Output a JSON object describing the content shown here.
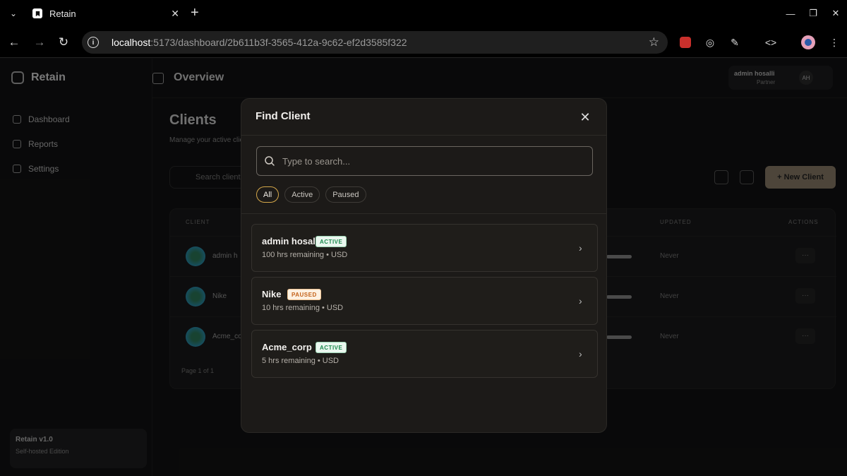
{
  "browser": {
    "tab_title": "Retain",
    "url_host": "localhost",
    "url_path": ":5173/dashboard/2b611b3f-3565-412a-9c62-ef2d3585f322"
  },
  "app_bg": {
    "brand": "Retain",
    "nav": [
      "Dashboard",
      "Reports",
      "Settings"
    ],
    "version_title": "Retain v1.0",
    "version_sub": "Self-hosted Edition",
    "topbar_title": "Overview",
    "user_name": "admin hosalli",
    "user_role": "Partner",
    "user_initials": "AH",
    "page_title": "Clients",
    "page_sub": "Manage your active clients",
    "search_placeholder": "Search clients...",
    "new_client": "+ New Client",
    "headers": {
      "client": "CLIENT",
      "updated": "UPDATED",
      "actions": "ACTIONS"
    },
    "rows": [
      {
        "name": "admin h",
        "updated": "Never"
      },
      {
        "name": "Nike",
        "updated": "Never"
      },
      {
        "name": "Acme_co",
        "updated": "Never"
      }
    ],
    "pager": "Page 1 of 1"
  },
  "modal": {
    "title": "Find Client",
    "search_placeholder": "Type to search...",
    "filters": [
      "All",
      "Active",
      "Paused"
    ],
    "active_filter": "All",
    "results": [
      {
        "name": "admin hosalli",
        "status": "ACTIVE",
        "meta": "100 hrs remaining • USD"
      },
      {
        "name": "Nike",
        "status": "PAUSED",
        "meta": "10 hrs remaining • USD"
      },
      {
        "name": "Acme_corp",
        "status": "ACTIVE",
        "meta": "5 hrs remaining • USD"
      }
    ]
  },
  "colors": {
    "accent_filter_border": "#d4a74a",
    "active_badge": "#1c8a4e",
    "paused_badge": "#c4621a"
  }
}
